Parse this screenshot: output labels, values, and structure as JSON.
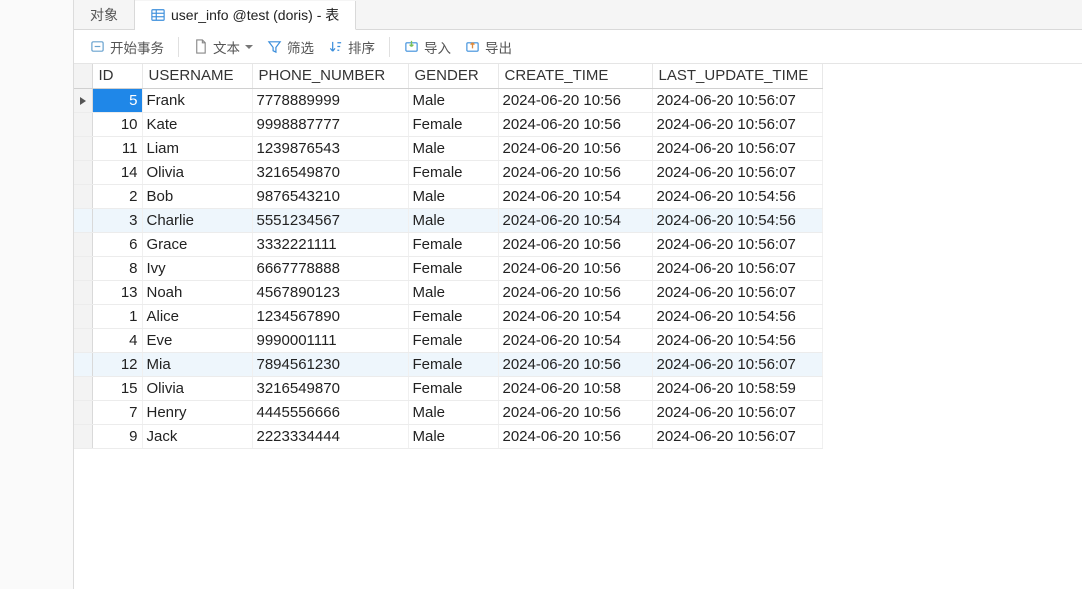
{
  "tabs": {
    "objects": "对象",
    "active": "user_info @test (doris) - 表"
  },
  "toolbar": {
    "begin_tx": "开始事务",
    "text": "文本",
    "filter": "筛选",
    "sort": "排序",
    "import": "导入",
    "export": "导出"
  },
  "columns": {
    "id": "ID",
    "username": "USERNAME",
    "phone": "PHONE_NUMBER",
    "gender": "GENDER",
    "create_time": "CREATE_TIME",
    "update_time": "LAST_UPDATE_TIME"
  },
  "rows": [
    {
      "id": 5,
      "username": "Frank",
      "phone": "7778889999",
      "gender": "Male",
      "ct": "2024-06-20 10:56",
      "ut": "2024-06-20 10:56:07",
      "selected": true
    },
    {
      "id": 10,
      "username": "Kate",
      "phone": "9998887777",
      "gender": "Female",
      "ct": "2024-06-20 10:56",
      "ut": "2024-06-20 10:56:07"
    },
    {
      "id": 11,
      "username": "Liam",
      "phone": "1239876543",
      "gender": "Male",
      "ct": "2024-06-20 10:56",
      "ut": "2024-06-20 10:56:07"
    },
    {
      "id": 14,
      "username": "Olivia",
      "phone": "3216549870",
      "gender": "Female",
      "ct": "2024-06-20 10:56",
      "ut": "2024-06-20 10:56:07"
    },
    {
      "id": 2,
      "username": "Bob",
      "phone": "9876543210",
      "gender": "Male",
      "ct": "2024-06-20 10:54",
      "ut": "2024-06-20 10:54:56"
    },
    {
      "id": 3,
      "username": "Charlie",
      "phone": "5551234567",
      "gender": "Male",
      "ct": "2024-06-20 10:54",
      "ut": "2024-06-20 10:54:56",
      "highlight": true
    },
    {
      "id": 6,
      "username": "Grace",
      "phone": "3332221111",
      "gender": "Female",
      "ct": "2024-06-20 10:56",
      "ut": "2024-06-20 10:56:07"
    },
    {
      "id": 8,
      "username": "Ivy",
      "phone": "6667778888",
      "gender": "Female",
      "ct": "2024-06-20 10:56",
      "ut": "2024-06-20 10:56:07"
    },
    {
      "id": 13,
      "username": "Noah",
      "phone": "4567890123",
      "gender": "Male",
      "ct": "2024-06-20 10:56",
      "ut": "2024-06-20 10:56:07"
    },
    {
      "id": 1,
      "username": "Alice",
      "phone": "1234567890",
      "gender": "Female",
      "ct": "2024-06-20 10:54",
      "ut": "2024-06-20 10:54:56"
    },
    {
      "id": 4,
      "username": "Eve",
      "phone": "9990001111",
      "gender": "Female",
      "ct": "2024-06-20 10:54",
      "ut": "2024-06-20 10:54:56"
    },
    {
      "id": 12,
      "username": "Mia",
      "phone": "7894561230",
      "gender": "Female",
      "ct": "2024-06-20 10:56",
      "ut": "2024-06-20 10:56:07",
      "highlight": true
    },
    {
      "id": 15,
      "username": "Olivia",
      "phone": "3216549870",
      "gender": "Female",
      "ct": "2024-06-20 10:58",
      "ut": "2024-06-20 10:58:59"
    },
    {
      "id": 7,
      "username": "Henry",
      "phone": "4445556666",
      "gender": "Male",
      "ct": "2024-06-20 10:56",
      "ut": "2024-06-20 10:56:07"
    },
    {
      "id": 9,
      "username": "Jack",
      "phone": "2223334444",
      "gender": "Male",
      "ct": "2024-06-20 10:56",
      "ut": "2024-06-20 10:56:07"
    }
  ]
}
